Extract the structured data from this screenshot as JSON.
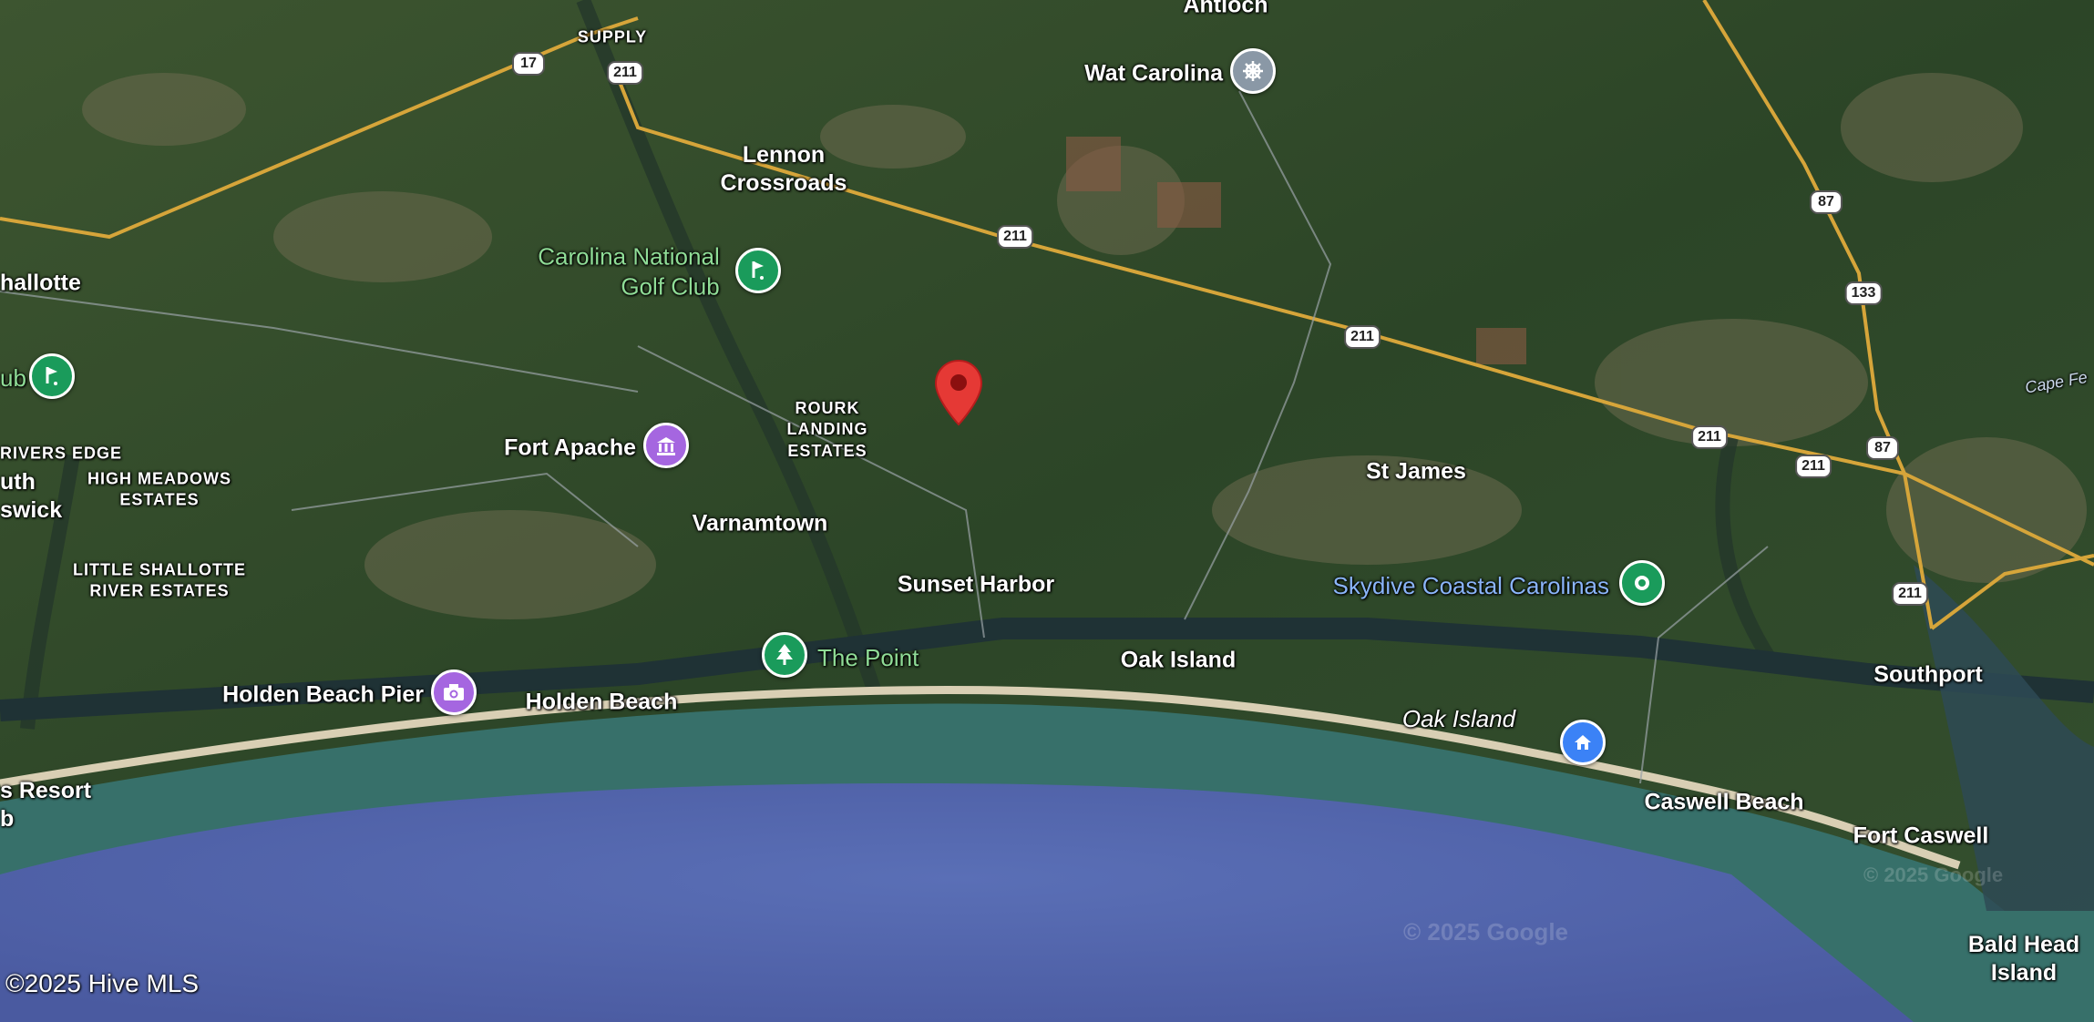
{
  "places": {
    "antioch": "Antioch",
    "wat_carolina": "Wat Carolina",
    "supply": "SUPPLY",
    "lennon_crossroads": "Lennon\nCrossroads",
    "carolina_national_golf_club": "Carolina National\nGolf Club",
    "shallotte": "hallotte",
    "club_fragment": "ub",
    "rivers_edge": "RIVERS EDGE",
    "south_brunswick": "uth\nswick",
    "high_meadows_estates": "HIGH MEADOWS\nESTATES",
    "little_shallotte_river_estates": "LITTLE SHALLOTTE\nRIVER ESTATES",
    "fort_apache": "Fort Apache",
    "rourk_landing_estates": "ROURK\nLANDING\nESTATES",
    "varnamtown": "Varnamtown",
    "sunset_harbor": "Sunset Harbor",
    "the_point": "The Point",
    "holden_beach_pier": "Holden Beach Pier",
    "holden_beach": "Holden Beach",
    "oak_island_town": "Oak Island",
    "oak_island_italic": "Oak Island",
    "st_james": "St James",
    "skydive_coastal_carolinas": "Skydive Coastal Carolinas",
    "cape_fear": "Cape Fe",
    "southport": "Southport",
    "caswell_beach": "Caswell Beach",
    "fort_caswell": "Fort Caswell",
    "bald_head_island": "Bald Head\nIsland",
    "resort_fragment": "s Resort\nb"
  },
  "routes": {
    "us17": "17",
    "nc211_a": "211",
    "nc211_b": "211",
    "nc211_c": "211",
    "nc211_d": "211",
    "nc211_e": "211",
    "nc211_f": "211",
    "nc87_a": "87",
    "nc87_b": "87",
    "nc133": "133"
  },
  "poi_icons": {
    "golf": "golf-icon",
    "museum": "museum-icon",
    "park": "tree-icon",
    "camera": "camera-icon",
    "temple": "dharma-wheel-icon",
    "skydive": "location-dot-icon",
    "home": "home-icon",
    "listing": "red-location-pin-icon"
  },
  "colors": {
    "ocean": "#4f63a8",
    "land": "#2f4a2a",
    "beach": "#d9cfb4",
    "pin": "#e53935",
    "poi_green": "#1a9b5b",
    "poi_purple": "#a566e0",
    "poi_blue": "#3b82f6",
    "road": "#d6a53a"
  },
  "watermarks": {
    "google_1": "© 2025 Google",
    "google_2": "© 2025 Google"
  },
  "copyright": "©2025 Hive MLS"
}
